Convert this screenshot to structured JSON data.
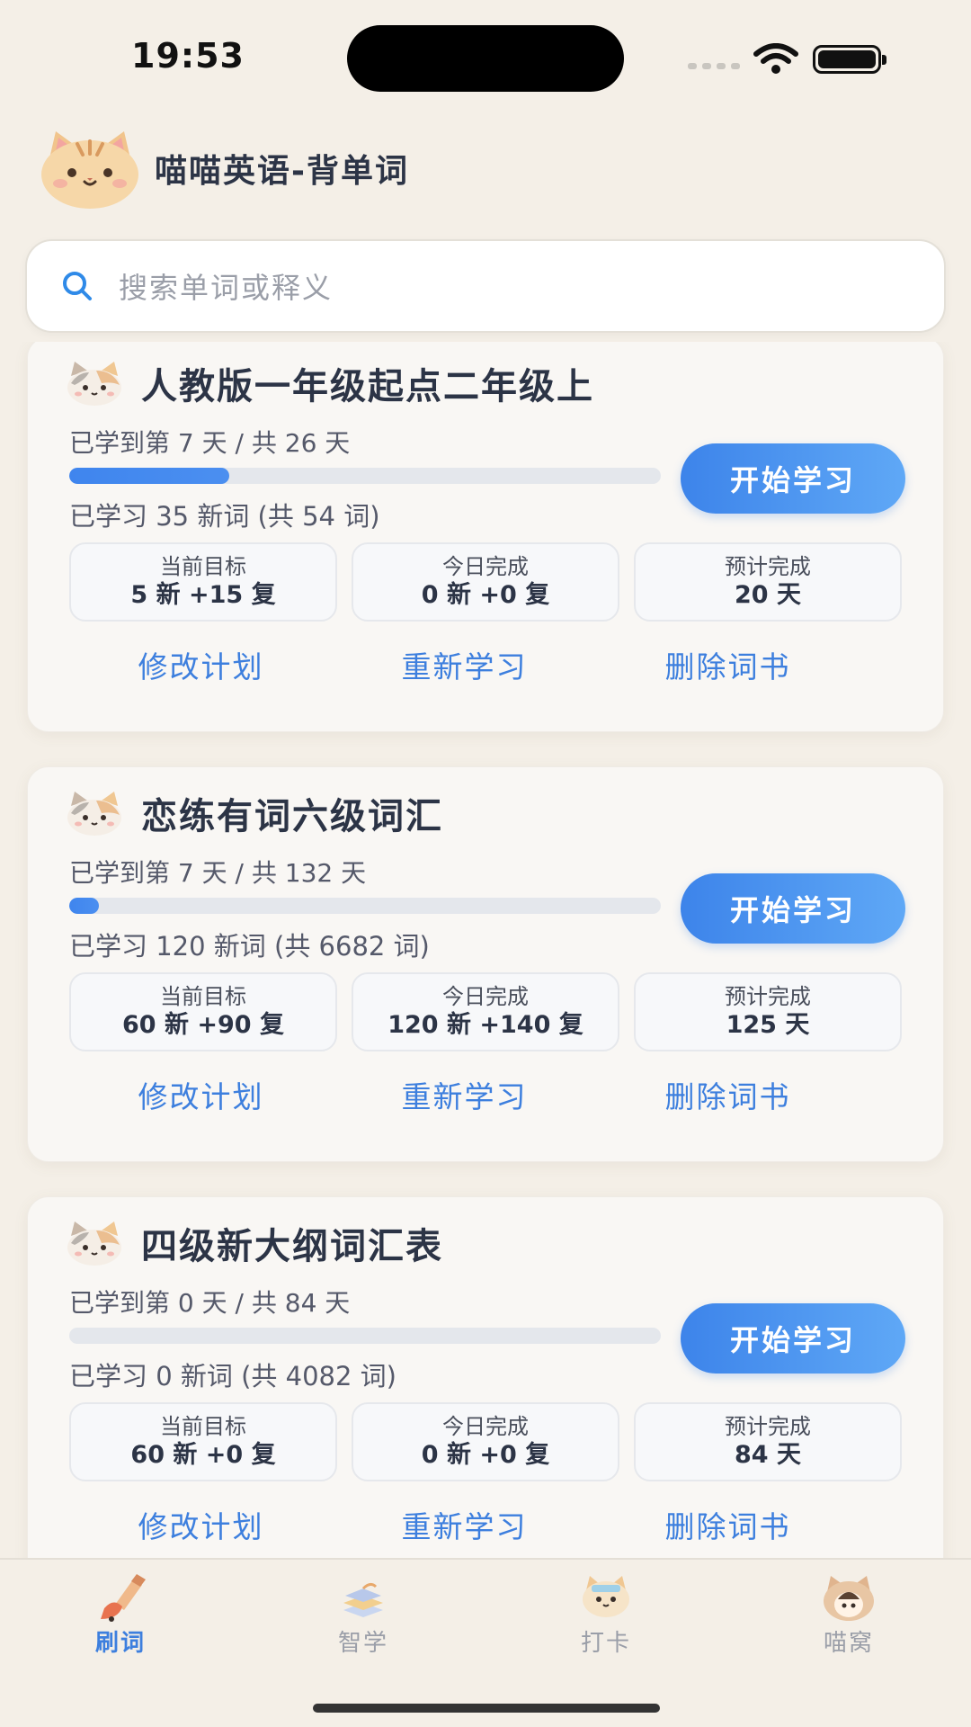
{
  "status_bar": {
    "time": "19:53"
  },
  "header": {
    "app_title": "喵喵英语-背单词"
  },
  "search": {
    "placeholder": "搜索单词或释义"
  },
  "books": [
    {
      "title": "人教版一年级起点二年级上",
      "days_text": "已学到第 7 天 / 共 26 天",
      "progress": 0.27,
      "words_text": "已学习 35 新词 (共 54 词)",
      "start_label": "开始学习",
      "stats": [
        {
          "label": "当前目标",
          "value": "5 新 +15 复"
        },
        {
          "label": "今日完成",
          "value": "0 新 +0 复"
        },
        {
          "label": "预计完成",
          "value": "20 天"
        }
      ],
      "actions": [
        "修改计划",
        "重新学习",
        "删除词书"
      ]
    },
    {
      "title": "恋练有词六级词汇",
      "days_text": "已学到第 7 天 / 共 132 天",
      "progress": 0.05,
      "words_text": "已学习 120 新词 (共 6682 词)",
      "start_label": "开始学习",
      "stats": [
        {
          "label": "当前目标",
          "value": "60 新 +90 复"
        },
        {
          "label": "今日完成",
          "value": "120 新 +140 复"
        },
        {
          "label": "预计完成",
          "value": "125 天"
        }
      ],
      "actions": [
        "修改计划",
        "重新学习",
        "删除词书"
      ]
    },
    {
      "title": "四级新大纲词汇表",
      "days_text": "已学到第 0 天 / 共 84 天",
      "progress": 0,
      "words_text": "已学习 0 新词 (共 4082 词)",
      "start_label": "开始学习",
      "stats": [
        {
          "label": "当前目标",
          "value": "60 新 +0 复"
        },
        {
          "label": "今日完成",
          "value": "0 新 +0 复"
        },
        {
          "label": "预计完成",
          "value": "84 天"
        }
      ],
      "actions": [
        "修改计划",
        "重新学习",
        "删除词书"
      ]
    }
  ],
  "tabs": [
    {
      "label": "刷词",
      "icon": "brush-icon",
      "active": true
    },
    {
      "label": "智学",
      "icon": "books-icon",
      "active": false
    },
    {
      "label": "打卡",
      "icon": "cat-checkin-icon",
      "active": false
    },
    {
      "label": "喵窝",
      "icon": "cat-home-icon",
      "active": false
    }
  ],
  "colors": {
    "accent": "#3d7fde",
    "background": "#f4efe7",
    "progress": "#3f85ee"
  }
}
